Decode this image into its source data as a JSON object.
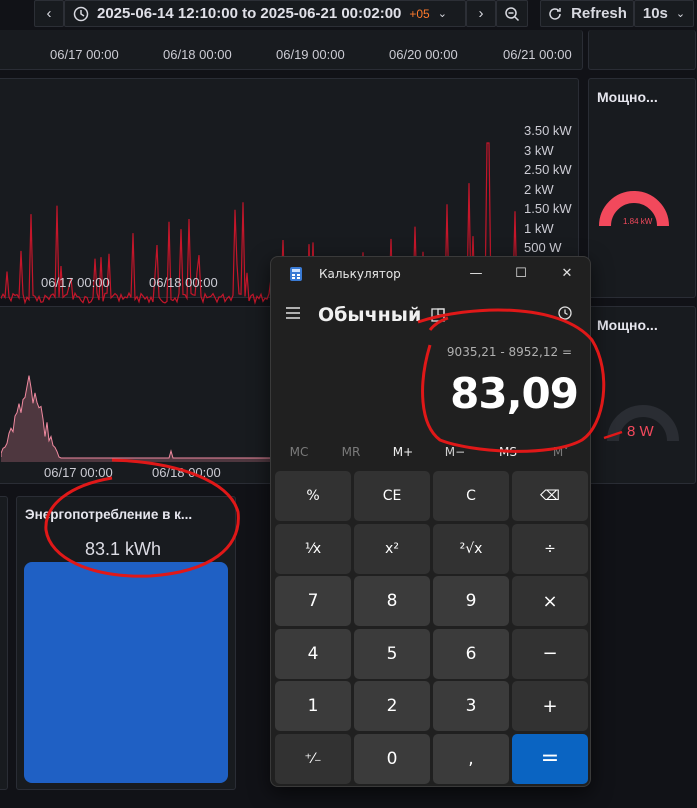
{
  "toolbar": {
    "prev": "‹",
    "time_range": "2025-06-14 12:10:00 to 2025-06-21 00:02:00",
    "tz_offset": "+05",
    "next": "›",
    "refresh_label": "Refresh",
    "refresh_interval": "10s"
  },
  "top_axis": [
    "06/17 00:00",
    "06/18 00:00",
    "06/19 00:00",
    "06/20 00:00",
    "06/21 00:00"
  ],
  "power_chart": {
    "x_ticks": [
      "06/17 00:00",
      "06/18 00:00"
    ],
    "y_ticks": [
      "3.50 kW",
      "3 kW",
      "2.50 kW",
      "2 kW",
      "1.50 kW",
      "1 kW",
      "500 W"
    ],
    "line_color": "#c4162a"
  },
  "second_chart": {
    "x_ticks": [
      "06/17 00:00",
      "06/18 00:00"
    ],
    "line_color": "#f08aa0"
  },
  "gauge1": {
    "title": "Мощно...",
    "value": "1.84 kW",
    "color": "#f2495c"
  },
  "gauge2": {
    "title": "Мощно...",
    "value": "8 W",
    "color": "#f2495c"
  },
  "energy_panel": {
    "title": "Энергопотребление в к...",
    "value": "83.1 kWh",
    "fill_color": "#1f60c4"
  },
  "calculator": {
    "window_title": "Калькулятор",
    "mode": "Обычный",
    "expression": "9035,21 - 8952,12 =",
    "result": "83,09",
    "memory": [
      "MC",
      "MR",
      "M+",
      "M−",
      "MS",
      "M˅"
    ],
    "keys": [
      [
        "%",
        "CE",
        "C",
        "⌫"
      ],
      [
        "¹⁄x",
        "x²",
        "²√x",
        "÷"
      ],
      [
        "7",
        "8",
        "9",
        "×"
      ],
      [
        "4",
        "5",
        "6",
        "−"
      ],
      [
        "1",
        "2",
        "3",
        "+"
      ],
      [
        "⁺⁄₋",
        "0",
        ",",
        "="
      ]
    ]
  }
}
